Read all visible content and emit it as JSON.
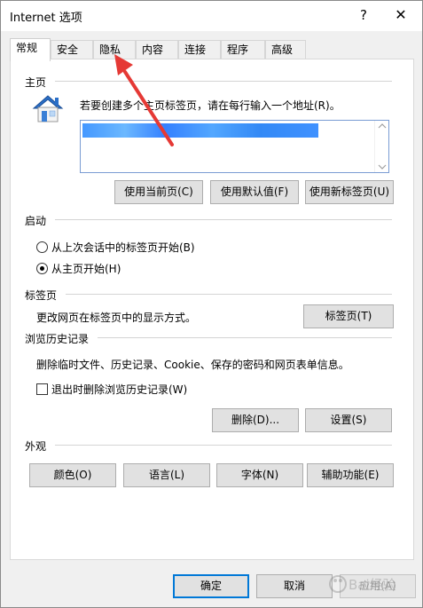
{
  "window": {
    "title": "Internet 选项",
    "help": "?",
    "close": "✕"
  },
  "tabs": [
    {
      "label": "常规",
      "active": true
    },
    {
      "label": "安全",
      "active": false
    },
    {
      "label": "隐私",
      "active": false
    },
    {
      "label": "内容",
      "active": false
    },
    {
      "label": "连接",
      "active": false
    },
    {
      "label": "程序",
      "active": false
    },
    {
      "label": "高级",
      "active": false
    }
  ],
  "home": {
    "title": "主页",
    "instruction": "若要创建多个主页标签页，请在每行输入一个地址(R)。",
    "buttons": {
      "use_current": "使用当前页(C)",
      "use_default": "使用默认值(F)",
      "use_new_tab": "使用新标签页(U)"
    }
  },
  "startup": {
    "title": "启动",
    "options": [
      {
        "label": "从上次会话中的标签页开始(B)",
        "checked": false
      },
      {
        "label": "从主页开始(H)",
        "checked": true
      }
    ]
  },
  "tabs_section": {
    "title": "标签页",
    "description": "更改网页在标签页中的显示方式。",
    "button": "标签页(T)"
  },
  "history": {
    "title": "浏览历史记录",
    "description": "删除临时文件、历史记录、Cookie、保存的密码和网页表单信息。",
    "checkbox": {
      "label": "退出时删除浏览历史记录(W)",
      "checked": false
    },
    "buttons": {
      "delete": "删除(D)...",
      "settings": "设置(S)"
    }
  },
  "appearance": {
    "title": "外观",
    "buttons": {
      "colors": "颜色(O)",
      "languages": "语言(L)",
      "fonts": "字体(N)",
      "accessibility": "辅助功能(E)"
    }
  },
  "footer": {
    "ok": "确定",
    "cancel": "取消",
    "apply": "应用(A)"
  },
  "watermark": {
    "text": "Bai经验"
  },
  "colors": {
    "accent": "#0078d7",
    "annotation_arrow": "#e53935",
    "house_roof": "#2a6fc8",
    "url_highlight": "#2f8cff"
  }
}
